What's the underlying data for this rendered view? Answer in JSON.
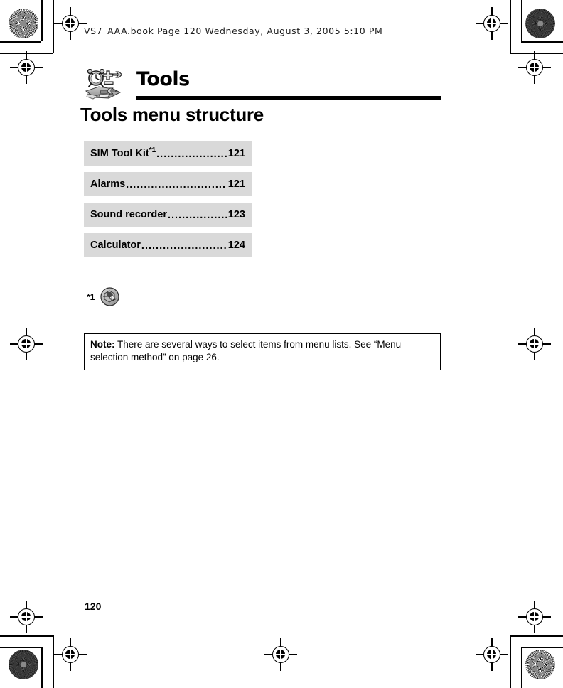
{
  "page": {
    "running_header": "VS7_AAA.book  Page 120  Wednesday, August 3, 2005  5:10 PM",
    "folio": "120"
  },
  "chapter": {
    "icon_name": "tools-chapter-icon",
    "title": "Tools",
    "section_title": "Tools menu structure"
  },
  "menu_table": {
    "leader_dots": "................................................................",
    "rows": [
      {
        "label": "SIM Tool Kit",
        "footnote": "*1",
        "page": "121"
      },
      {
        "label": "Alarms",
        "footnote": "",
        "page": "121"
      },
      {
        "label": "Sound recorder",
        "footnote": "",
        "page": "123"
      },
      {
        "label": "Calculator",
        "footnote": "",
        "page": "124"
      }
    ]
  },
  "footnote": {
    "marker": "*1",
    "icon_name": "sim-card-badge-icon"
  },
  "note": {
    "label": "Note:",
    "text": "There are several ways to select items from menu lists. See “Menu selection method” on page 26."
  },
  "colors": {
    "row_fill": "#d9d9d9",
    "ink": "#000000",
    "paper": "#ffffff"
  }
}
